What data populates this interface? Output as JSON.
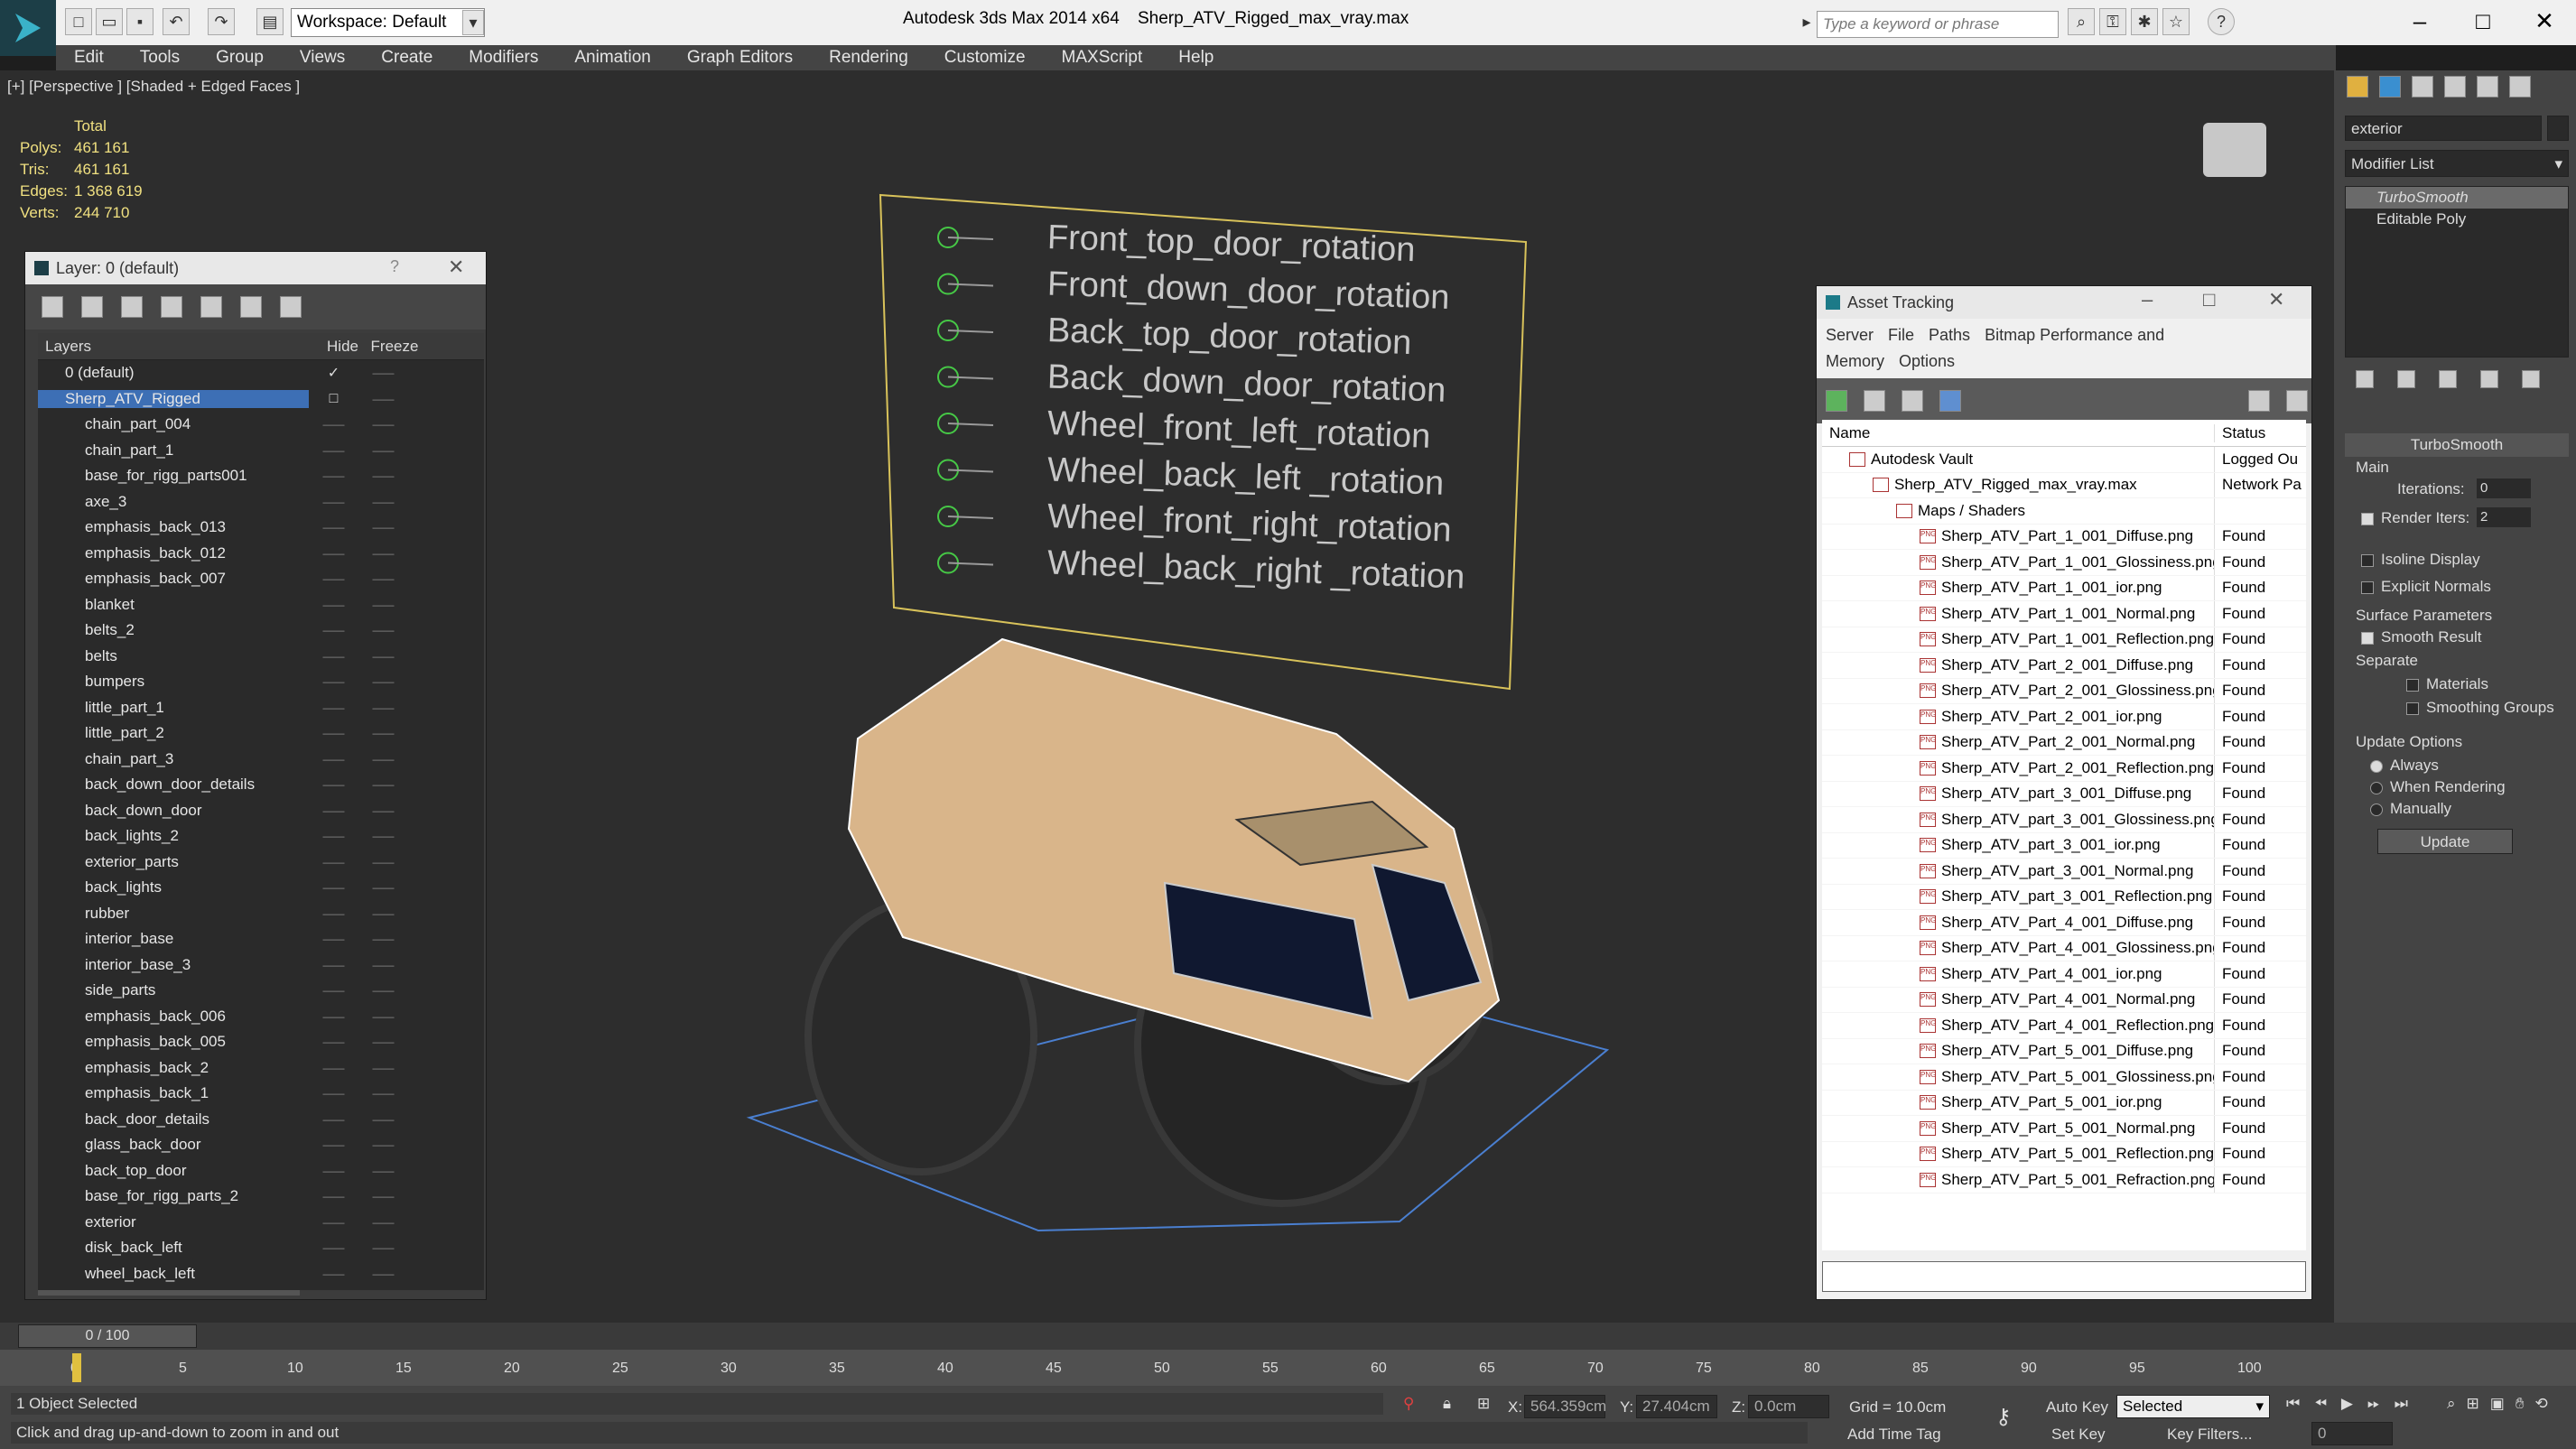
{
  "app": {
    "title": "Autodesk 3ds Max  2014 x64",
    "filename": "Sherp_ATV_Rigged_max_vray.max",
    "workspace": "Workspace: Default",
    "search_placeholder": "Type a keyword or phrase"
  },
  "menu": [
    "Edit",
    "Tools",
    "Group",
    "Views",
    "Create",
    "Modifiers",
    "Animation",
    "Graph Editors",
    "Rendering",
    "Customize",
    "MAXScript",
    "Help"
  ],
  "viewport": {
    "label": "[+] [Perspective ] [Shaded + Edged Faces ]",
    "stats": {
      "header": "Total",
      "rows": [
        [
          "Polys:",
          "461 161"
        ],
        [
          "Tris:",
          "461 161"
        ],
        [
          "Edges:",
          "1 368 619"
        ],
        [
          "Verts:",
          "244 710"
        ]
      ]
    },
    "rig_labels": [
      "Front_top_door_rotation",
      "Front_down_door_rotation",
      "Back_top_door_rotation",
      "Back_down_door_rotation",
      "Wheel_front_left_rotation",
      "Wheel_back_left _rotation",
      "Wheel_front_right_rotation",
      "Wheel_back_right _rotation"
    ]
  },
  "layer_panel": {
    "title": "Layer: 0 (default)",
    "help": "?",
    "col_layers": "Layers",
    "col_hide": "Hide",
    "col_freeze": "Freeze",
    "top": [
      "0 (default)",
      "Sherp_ATV_Rigged"
    ],
    "items": [
      "chain_part_004",
      "chain_part_1",
      "base_for_rigg_parts001",
      "axe_3",
      "emphasis_back_013",
      "emphasis_back_012",
      "emphasis_back_007",
      "blanket",
      "belts_2",
      "belts",
      "bumpers",
      "little_part_1",
      "little_part_2",
      "chain_part_3",
      "back_down_door_details",
      "back_down_door",
      "back_lights_2",
      "exterior_parts",
      "back_lights",
      "rubber",
      "interior_base",
      "interior_base_3",
      "side_parts",
      "emphasis_back_006",
      "emphasis_back_005",
      "emphasis_back_2",
      "emphasis_back_1",
      "back_door_details",
      "glass_back_door",
      "back_top_door",
      "base_for_rigg_parts_2",
      "exterior",
      "disk_back_left",
      "wheel_back_left"
    ]
  },
  "asset_panel": {
    "title": "Asset Tracking",
    "menu": [
      "Server",
      "File",
      "Paths",
      "Bitmap Performance and Memory",
      "Options"
    ],
    "col_name": "Name",
    "col_status": "Status",
    "vault": [
      "Autodesk Vault",
      "Logged Ou"
    ],
    "file": [
      "Sherp_ATV_Rigged_max_vray.max",
      "Network Pa"
    ],
    "maps": "Maps / Shaders",
    "found": "Found",
    "files": [
      "Sherp_ATV_Part_1_001_Diffuse.png",
      "Sherp_ATV_Part_1_001_Glossiness.png",
      "Sherp_ATV_Part_1_001_ior.png",
      "Sherp_ATV_Part_1_001_Normal.png",
      "Sherp_ATV_Part_1_001_Reflection.png",
      "Sherp_ATV_Part_2_001_Diffuse.png",
      "Sherp_ATV_Part_2_001_Glossiness.png",
      "Sherp_ATV_Part_2_001_ior.png",
      "Sherp_ATV_Part_2_001_Normal.png",
      "Sherp_ATV_Part_2_001_Reflection.png",
      "Sherp_ATV_part_3_001_Diffuse.png",
      "Sherp_ATV_part_3_001_Glossiness.png",
      "Sherp_ATV_part_3_001_ior.png",
      "Sherp_ATV_part_3_001_Normal.png",
      "Sherp_ATV_part_3_001_Reflection.png",
      "Sherp_ATV_Part_4_001_Diffuse.png",
      "Sherp_ATV_Part_4_001_Glossiness.png",
      "Sherp_ATV_Part_4_001_ior.png",
      "Sherp_ATV_Part_4_001_Normal.png",
      "Sherp_ATV_Part_4_001_Reflection.png",
      "Sherp_ATV_Part_5_001_Diffuse.png",
      "Sherp_ATV_Part_5_001_Glossiness.png",
      "Sherp_ATV_Part_5_001_ior.png",
      "Sherp_ATV_Part_5_001_Normal.png",
      "Sherp_ATV_Part_5_001_Reflection.png",
      "Sherp_ATV_Part_5_001_Refraction.png"
    ]
  },
  "command_panel": {
    "object_name": "exterior",
    "modifier_list": "Modifier List",
    "stack": [
      "TurboSmooth",
      "Editable Poly"
    ],
    "rollout": "TurboSmooth",
    "main": "Main",
    "iterations_label": "Iterations:",
    "iterations": "0",
    "render_iters_label": "Render Iters:",
    "render_iters": "2",
    "isoline": "Isoline Display",
    "explicit": "Explicit Normals",
    "surface": "Surface Parameters",
    "smooth_result": "Smooth Result",
    "separate": "Separate",
    "materials": "Materials",
    "smoothing": "Smoothing Groups",
    "update_opts": "Update Options",
    "always": "Always",
    "when_rendering": "When Rendering",
    "manually": "Manually",
    "update": "Update"
  },
  "timeline": {
    "frame": "0 / 100",
    "ticks": [
      "0",
      "5",
      "10",
      "15",
      "20",
      "25",
      "30",
      "35",
      "40",
      "45",
      "50",
      "55",
      "60",
      "65",
      "70",
      "75",
      "80",
      "85",
      "90",
      "95",
      "100"
    ]
  },
  "status": {
    "selected": "1 Object Selected",
    "hint": "Click and drag up-and-down to zoom in and out",
    "x_label": "X:",
    "x": "564.359cm",
    "y_label": "Y:",
    "y": "27.404cm",
    "z_label": "Z:",
    "z": "0.0cm",
    "grid": "Grid = 10.0cm",
    "auto_key": "Auto Key",
    "set_key": "Set Key",
    "selected_dd": "Selected",
    "key_filters": "Key Filters...",
    "add_time_tag": "Add Time Tag",
    "frame": "0"
  },
  "colors": {
    "accent": "#3d6fb5",
    "vehicle": "#d9b58a",
    "rig_text": "#c8c8c8",
    "rig_circle": "#46c846"
  }
}
